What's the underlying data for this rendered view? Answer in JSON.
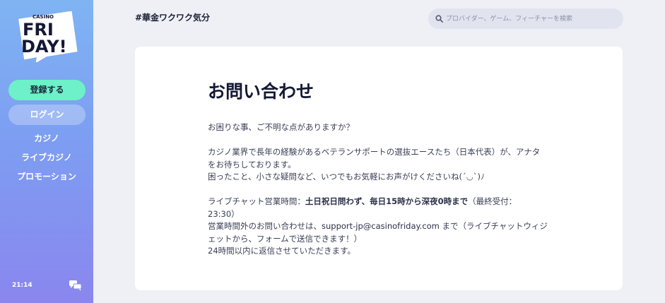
{
  "sidebar": {
    "logo": {
      "small_text": "CASINO",
      "line1": "FRI",
      "line2": "DAY!"
    },
    "register_label": "登録する",
    "login_label": "ログイン",
    "nav": [
      {
        "label": "カジノ"
      },
      {
        "label": "ライブカジノ"
      },
      {
        "label": "プロモーション"
      }
    ],
    "clock": "21:14",
    "chat_icon": "chat-bubbles-icon"
  },
  "header": {
    "tagline": "#華金ワクワク気分",
    "search": {
      "placeholder": "プロバイダー、ゲーム、フィーチャーを検索",
      "icon": "search-icon"
    }
  },
  "main": {
    "title": "お問い合わせ",
    "intro": "お困りな事、ご不明な点がありますか？",
    "para2_line1": "カジノ業界で長年の経験があるベテランサポートの選抜エースたち（日本代表）が、アナタ",
    "para2_line2": "をお待ちしております。",
    "para2_line3": "困ったこと、小さな疑問など、いつでもお気軽にお声がけくださいね(´◡`)ﾉ",
    "hours_prefix": "ライブチャット営業時間：",
    "hours_bold": "土日祝日問わず、毎日15時から深夜0時まで",
    "hours_suffix": "（最終受付：",
    "hours_line2": "23:30）",
    "offhours_prefix": "営業時間外のお問い合わせは、",
    "email": "support-jp@casinofriday.com",
    "offhours_suffix": "まで（ライブチャットウィジ",
    "offhours_line2": "ェットから、フォームで送信できます！）",
    "reply_note": "24時間以内に返信させていただきます。"
  },
  "colors": {
    "register_button": "#6ef0c8",
    "sidebar_top": "#7fb4f3",
    "sidebar_bottom": "#8a86ee"
  }
}
